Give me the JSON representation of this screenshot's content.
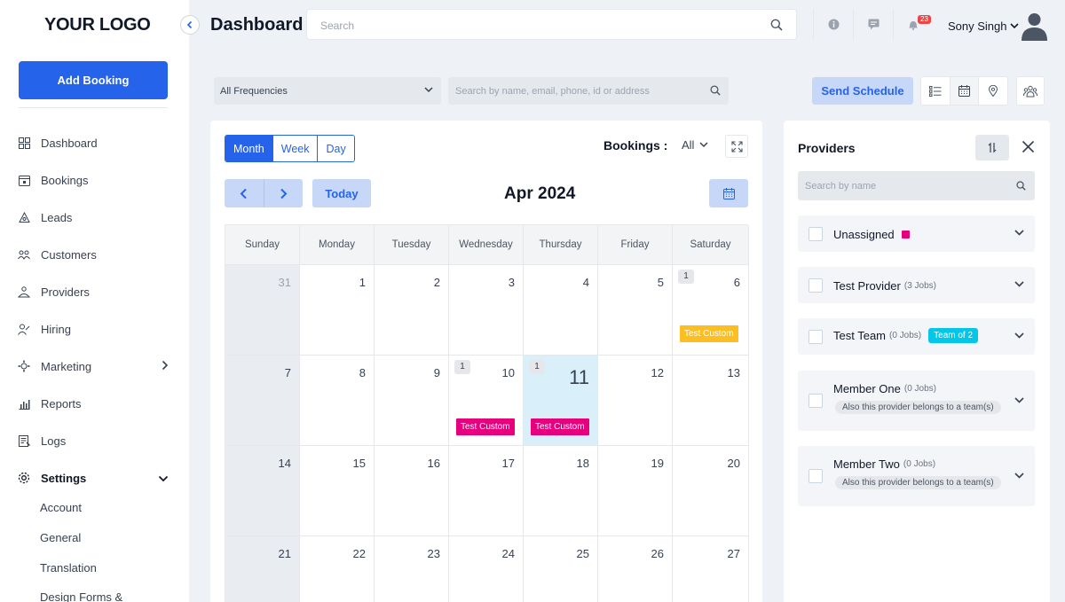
{
  "sidebar": {
    "logo": "YOUR LOGO",
    "add_booking": "Add Booking",
    "items": [
      {
        "label": "Dashboard",
        "icon": "dashboard-icon"
      },
      {
        "label": "Bookings",
        "icon": "bookings-icon"
      },
      {
        "label": "Leads",
        "icon": "leads-icon"
      },
      {
        "label": "Customers",
        "icon": "customers-icon"
      },
      {
        "label": "Providers",
        "icon": "providers-icon"
      },
      {
        "label": "Hiring",
        "icon": "hiring-icon"
      },
      {
        "label": "Marketing",
        "icon": "marketing-icon"
      },
      {
        "label": "Reports",
        "icon": "reports-icon"
      },
      {
        "label": "Logs",
        "icon": "logs-icon"
      },
      {
        "label": "Settings",
        "icon": "gear-icon"
      }
    ],
    "settings_sub": [
      "Account",
      "General",
      "Translation",
      "Design Forms &"
    ]
  },
  "header": {
    "title": "Dashboard",
    "search_placeholder": "Search",
    "notification_count": "23",
    "user_name": "Sony Singh"
  },
  "filters": {
    "frequency": "All Frequencies",
    "search_placeholder": "Search by name, email, phone, id or address",
    "send_schedule": "Send Schedule"
  },
  "calendar": {
    "views": [
      "Month",
      "Week",
      "Day"
    ],
    "active_view": "Month",
    "bookings_label": "Bookings :",
    "bookings_filter": "All",
    "today_label": "Today",
    "month_title": "Apr 2024",
    "weekdays": [
      "Sunday",
      "Monday",
      "Tuesday",
      "Wednesday",
      "Thursday",
      "Friday",
      "Saturday"
    ],
    "weeks": [
      [
        {
          "d": "31",
          "other": true
        },
        {
          "d": "1"
        },
        {
          "d": "2"
        },
        {
          "d": "3"
        },
        {
          "d": "4"
        },
        {
          "d": "5"
        },
        {
          "d": "6",
          "count": "1",
          "event": "Test Custom",
          "color": "yellow"
        }
      ],
      [
        {
          "d": "7"
        },
        {
          "d": "8"
        },
        {
          "d": "9"
        },
        {
          "d": "10",
          "count": "1",
          "event": "Test Custom",
          "color": "pink"
        },
        {
          "d": "11",
          "today": true,
          "count": "1",
          "event": "Test Custom",
          "color": "pink"
        },
        {
          "d": "12"
        },
        {
          "d": "13"
        }
      ],
      [
        {
          "d": "14"
        },
        {
          "d": "15"
        },
        {
          "d": "16"
        },
        {
          "d": "17"
        },
        {
          "d": "18"
        },
        {
          "d": "19"
        },
        {
          "d": "20"
        }
      ],
      [
        {
          "d": "21"
        },
        {
          "d": "22"
        },
        {
          "d": "23"
        },
        {
          "d": "24"
        },
        {
          "d": "25"
        },
        {
          "d": "26"
        },
        {
          "d": "27"
        }
      ]
    ]
  },
  "providers": {
    "title": "Providers",
    "search_placeholder": "Search by name",
    "list": [
      {
        "name": "Unassigned",
        "jobs": "",
        "swatch": "#e6007e"
      },
      {
        "name": "Test Provider",
        "jobs": "(3 Jobs)"
      },
      {
        "name": "Test Team",
        "jobs": "(0 Jobs)",
        "badge": "Team of 2"
      },
      {
        "name": "Member One",
        "jobs": "(0 Jobs)",
        "note": "Also this provider belongs to a team(s)"
      },
      {
        "name": "Member Two",
        "jobs": "(0 Jobs)",
        "note": "Also this provider belongs to a team(s)"
      }
    ]
  },
  "colors": {
    "primary": "#2563eb",
    "primary_light": "#c7d7f7",
    "event_pink": "#e6007e",
    "event_yellow": "#fbbf24",
    "team_badge": "#06c6e8",
    "today_bg": "#d9f0fb"
  }
}
